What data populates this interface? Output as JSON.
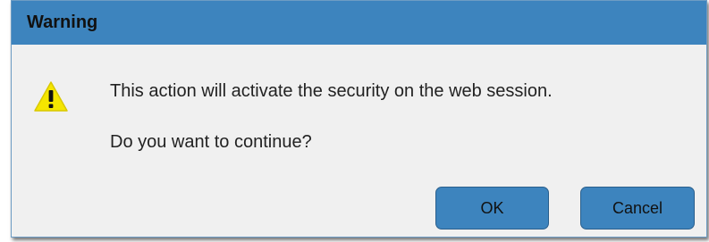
{
  "dialog": {
    "title": "Warning",
    "icon": "warning-icon",
    "message_line1": "This action will activate the security on the web session.",
    "message_line2": "Do you want to continue?",
    "buttons": {
      "ok_label": "OK",
      "cancel_label": "Cancel"
    }
  },
  "colors": {
    "titlebar": "#3d84be",
    "body": "#f0f0f0",
    "button": "#3d84be",
    "warning_fill": "#f5e600"
  }
}
